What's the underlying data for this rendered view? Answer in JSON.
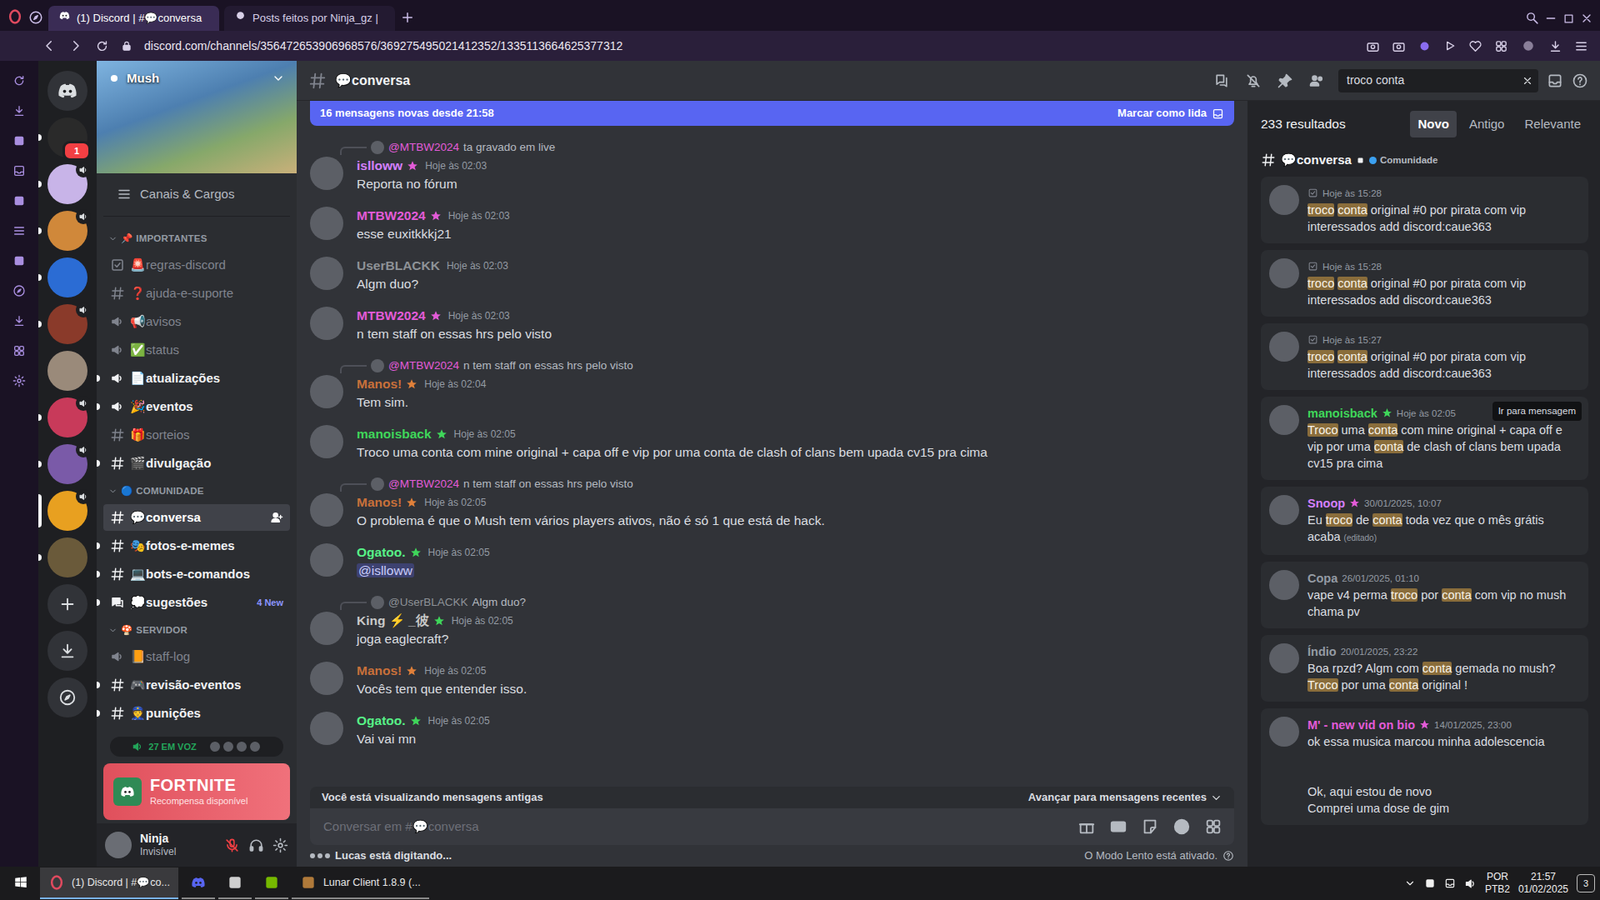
{
  "browser": {
    "tabs": [
      {
        "label": "(1) Discord | #💬conversa",
        "selected": true
      },
      {
        "label": "Posts feitos por Ninja_gz |",
        "selected": false
      }
    ],
    "url": "discord.com/channels/356472653906968576/369275495021412352/1335113664625377312"
  },
  "servers": [
    {
      "color": "#2a2a2a",
      "selected": false,
      "unread": true,
      "voice": false,
      "badge": "1"
    },
    {
      "color": "#c8b4e8",
      "selected": false,
      "unread": true,
      "voice": true
    },
    {
      "color": "#d0883a",
      "selected": false,
      "unread": true,
      "voice": true
    },
    {
      "color": "#2b6cd4",
      "selected": false,
      "unread": true,
      "voice": false
    },
    {
      "color": "#8a3a2a",
      "selected": false,
      "unread": true,
      "voice": true
    },
    {
      "color": "#9a8a7a",
      "selected": false,
      "unread": false,
      "voice": false
    },
    {
      "color": "#c83a5a",
      "selected": false,
      "unread": true,
      "voice": true
    },
    {
      "color": "#7a5aa8",
      "selected": false,
      "unread": true,
      "voice": true
    },
    {
      "color": "#e8a020",
      "selected": true,
      "unread": false,
      "voice": true
    },
    {
      "color": "#6a5a3a",
      "selected": false,
      "unread": true,
      "voice": false
    }
  ],
  "server": {
    "name": "Mush",
    "roles_link": "Canais & Cargos"
  },
  "categories": [
    {
      "name": "IMPORTANTES",
      "icon": "📌",
      "channels": [
        {
          "name": "🚨regras-discord",
          "kind": "rules",
          "unread": false,
          "selected": false
        },
        {
          "name": "❓ajuda-e-suporte",
          "kind": "text",
          "unread": false,
          "selected": false
        },
        {
          "name": "📢avisos",
          "kind": "announce",
          "unread": false,
          "selected": false
        },
        {
          "name": "✅status",
          "kind": "announce",
          "unread": false,
          "selected": false
        },
        {
          "name": "📄atualizações",
          "kind": "announce",
          "unread": true,
          "selected": false
        },
        {
          "name": "🎉eventos",
          "kind": "announce",
          "unread": true,
          "selected": false
        },
        {
          "name": "🎁sorteios",
          "kind": "text",
          "unread": false,
          "selected": false
        },
        {
          "name": "🎬divulgação",
          "kind": "text",
          "unread": true,
          "selected": false
        }
      ]
    },
    {
      "name": "COMUNIDADE",
      "icon": "🔵",
      "channels": [
        {
          "name": "💬conversa",
          "kind": "text",
          "unread": true,
          "selected": true
        },
        {
          "name": "🎭fotos-e-memes",
          "kind": "text",
          "unread": true,
          "selected": false
        },
        {
          "name": "💻bots-e-comandos",
          "kind": "text",
          "unread": true,
          "selected": false
        },
        {
          "name": "💭sugestões",
          "kind": "forum",
          "unread": true,
          "selected": false,
          "badge": "4 New"
        }
      ]
    },
    {
      "name": "SERVIDOR",
      "icon": "🍄",
      "channels": [
        {
          "name": "📙staff-log",
          "kind": "announce",
          "unread": false,
          "selected": false
        },
        {
          "name": "🎮revisão-eventos",
          "kind": "text",
          "unread": true,
          "selected": false
        },
        {
          "name": "👮punições",
          "kind": "text",
          "unread": true,
          "selected": false
        }
      ]
    }
  ],
  "voice": {
    "count": "27 EM VOZ"
  },
  "promo": {
    "title": "FORTNITE",
    "subtitle": "Recompensa disponível"
  },
  "user": {
    "name": "Ninja",
    "status": "Invisível",
    "mic_muted": true
  },
  "header": {
    "channel": "💬conversa",
    "search": "troco conta"
  },
  "banner": {
    "text": "16 mensagens novas desde 21:58",
    "action": "Marcar como lida"
  },
  "messages": [
    {
      "reply": {
        "author": "@MTBW2024",
        "color": "#e35bd8",
        "text": "ta gravado em live"
      },
      "author": "islloww",
      "color": "#d580ff",
      "badge_color": "#e35bd8",
      "time": "Hoje às 02:03",
      "text": "Reporta no fórum"
    },
    {
      "author": "MTBW2024",
      "color": "#e35bd8",
      "badge_color": "#e35bd8",
      "time": "Hoje às 02:03",
      "text": "esse euxitkkkj21"
    },
    {
      "author": "UserBLACKK",
      "color": "#8e9297",
      "time": "Hoje às 02:03",
      "text": "Algm duo?"
    },
    {
      "author": "MTBW2024",
      "color": "#e35bd8",
      "badge_color": "#e35bd8",
      "time": "Hoje às 02:03",
      "text": "n tem staff on essas hrs pelo visto"
    },
    {
      "reply": {
        "author": "@MTBW2024",
        "color": "#e35bd8",
        "text": "n tem staff on essas hrs pelo visto"
      },
      "author": "Manos!",
      "color": "#c8703a",
      "badge_color": "#e0803a",
      "time": "Hoje às 02:04",
      "text": "Tem sim."
    },
    {
      "author": "manoisback",
      "color": "#3fd65a",
      "badge_color": "#3fd65a",
      "time": "Hoje às 02:05",
      "text": "Troco uma conta com mine original + capa off e vip por uma conta de clash of clans  bem upada cv15 pra cima"
    },
    {
      "reply": {
        "author": "@MTBW2024",
        "color": "#e35bd8",
        "text": "n tem staff on essas hrs pelo visto"
      },
      "author": "Manos!",
      "color": "#c8703a",
      "badge_color": "#e0803a",
      "time": "Hoje às 02:05",
      "text": "O problema é que o Mush tem vários players ativos, não é só 1 que está de hack."
    },
    {
      "author": "Ogatoo.",
      "color": "#57f287",
      "badge_color": "#3fd65a",
      "time": "Hoje às 02:05",
      "mention": "@islloww"
    },
    {
      "reply": {
        "author": "@UserBLACKK",
        "color": "#8e9297",
        "text": "Algm duo?"
      },
      "author": "King ⚡ _彼",
      "color": "#c9c9c9",
      "badge_color": "#3fd65a",
      "time": "Hoje às 02:05",
      "text": "joga eaglecraft?"
    },
    {
      "author": "Manos!",
      "color": "#c8703a",
      "badge_color": "#e0803a",
      "time": "Hoje às 02:05",
      "text": "Vocês tem que entender isso."
    },
    {
      "author": "Ogatoo.",
      "color": "#57f287",
      "badge_color": "#3fd65a",
      "time": "Hoje às 02:05",
      "text": "Vai vai mn"
    }
  ],
  "composer": {
    "old_notice": "Você está visualizando mensagens antigas",
    "jump": "Avançar para mensagens recentes",
    "placeholder": "Conversar em #💬conversa",
    "typing": "Lucas está digitando...",
    "slowmode": "O Modo Lento está ativado."
  },
  "search": {
    "count": "233 resultados",
    "sorts": [
      {
        "label": "Novo",
        "selected": true
      },
      {
        "label": "Antigo",
        "selected": false
      },
      {
        "label": "Relevante",
        "selected": false
      }
    ],
    "group": {
      "channel": "💬conversa",
      "category": "Comunidade"
    },
    "jump_label": "Ir para mensagem",
    "results": [
      {
        "time": "Hoje às 15:28",
        "hovered": false,
        "parts": [
          {
            "t": "troco",
            "hl": true
          },
          {
            "t": " ",
            "hl": false
          },
          {
            "t": "conta",
            "hl": true
          },
          {
            "t": " original #0 por pirata com vip interessados add discord:caue363",
            "hl": false
          }
        ]
      },
      {
        "time": "Hoje às 15:28",
        "hovered": false,
        "parts": [
          {
            "t": "troco",
            "hl": true
          },
          {
            "t": " ",
            "hl": false
          },
          {
            "t": "conta",
            "hl": true
          },
          {
            "t": " original #0 por pirata com vip interessados add discord:caue363",
            "hl": false
          }
        ]
      },
      {
        "time": "Hoje às 15:27",
        "hovered": false,
        "parts": [
          {
            "t": "troco",
            "hl": true
          },
          {
            "t": " ",
            "hl": false
          },
          {
            "t": "conta",
            "hl": true
          },
          {
            "t": " original #0 por pirata com vip interessados add discord:caue363",
            "hl": false
          }
        ]
      },
      {
        "author": "manoisback",
        "color": "#3fd65a",
        "badge_color": "#3fd65a",
        "time": "Hoje às 02:05",
        "hovered": true,
        "parts": [
          {
            "t": "Troco",
            "hl": true
          },
          {
            "t": " uma ",
            "hl": false
          },
          {
            "t": "conta",
            "hl": true
          },
          {
            "t": " com mine original + capa off e vip por uma ",
            "hl": false
          },
          {
            "t": "conta",
            "hl": true
          },
          {
            "t": " de clash of clans bem upada cv15 pra cima",
            "hl": false
          }
        ]
      },
      {
        "author": "Snoop",
        "color": "#d580ff",
        "badge_color": "#e35bd8",
        "time": "30/01/2025, 10:07",
        "hovered": false,
        "edited": "(editado)",
        "parts": [
          {
            "t": "Eu ",
            "hl": false
          },
          {
            "t": "troco",
            "hl": true
          },
          {
            "t": " de ",
            "hl": false
          },
          {
            "t": "conta",
            "hl": true
          },
          {
            "t": " toda vez que o mês grátis acaba",
            "hl": false
          }
        ]
      },
      {
        "author": "Copa",
        "color": "#949ba4",
        "time": "26/01/2025, 01:10",
        "hovered": false,
        "parts": [
          {
            "t": "vape v4 perma ",
            "hl": false
          },
          {
            "t": "troco",
            "hl": true
          },
          {
            "t": " por ",
            "hl": false
          },
          {
            "t": "conta",
            "hl": true
          },
          {
            "t": " com vip no mush chama pv",
            "hl": false
          }
        ]
      },
      {
        "author": "Índio",
        "color": "#949ba4",
        "time": "20/01/2025, 23:22",
        "hovered": false,
        "parts": [
          {
            "t": "Boa rpzd? Algm com ",
            "hl": false
          },
          {
            "t": "conta",
            "hl": true
          },
          {
            "t": " gemada no mush? ",
            "hl": false
          },
          {
            "t": "Troco",
            "hl": true
          },
          {
            "t": " por uma ",
            "hl": false
          },
          {
            "t": "conta",
            "hl": true
          },
          {
            "t": " original !",
            "hl": false
          }
        ]
      },
      {
        "author": "M' - new vid on bio",
        "color": "#e35bd8",
        "badge_color": "#e35bd8",
        "time": "14/01/2025, 23:00",
        "hovered": false,
        "parts": [
          {
            "t": "ok essa musica marcou minha adolescencia\n\n\nOk, aqui estou de novo\nComprei uma dose de gim",
            "hl": false
          }
        ]
      }
    ]
  },
  "taskbar": {
    "apps": [
      {
        "kind": "opera",
        "label": "(1) Discord | #💬co...",
        "selected": true
      },
      {
        "kind": "discord",
        "selected": false
      },
      {
        "kind": "app",
        "selected": false
      },
      {
        "kind": "nvidia",
        "selected": false
      },
      {
        "kind": "lunar",
        "label": "Lunar Client 1.8.9 (...",
        "selected": false
      }
    ],
    "lang": "POR",
    "layout": "PTB2",
    "time": "21:57",
    "date": "01/02/2025",
    "notifications": "3"
  }
}
